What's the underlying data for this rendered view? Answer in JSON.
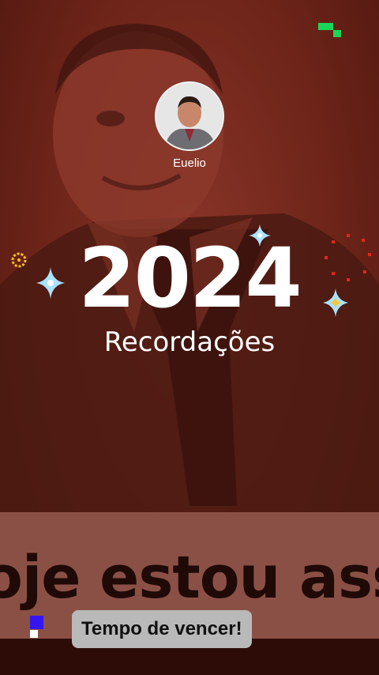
{
  "profile": {
    "name": "Euelio",
    "avatar_icon": "profile-photo"
  },
  "title": {
    "year": "2024",
    "subtitle": "Recordações"
  },
  "banner": {
    "text": "oje estou ass"
  },
  "caption": {
    "text": "Tempo de vencer!"
  },
  "colors": {
    "background": "#6d2419",
    "banner": "#8b5045",
    "caption_bg": "#b9b9b9",
    "accent_green": "#19d65a",
    "accent_blue": "#3416f0",
    "sparkle": "#a9e3ff"
  }
}
